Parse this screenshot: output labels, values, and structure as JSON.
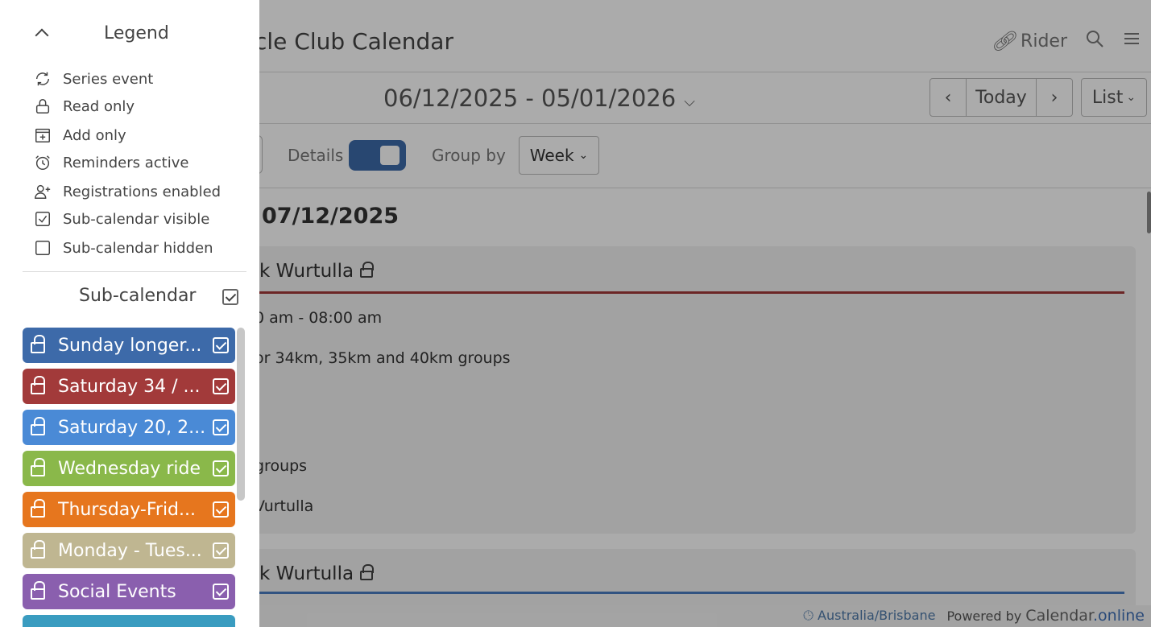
{
  "app": {
    "title_visible": "cle Club Calendar",
    "user_label": "Rider"
  },
  "nav": {
    "date_range": "06/12/2025 - 05/01/2026",
    "today_label": "Today",
    "view_label": "List"
  },
  "toolbar": {
    "details_label": "Details",
    "details_on": true,
    "group_by_label": "Group by",
    "group_by_value": "Week"
  },
  "agenda": {
    "date_heading": "07/12/2025",
    "events": [
      {
        "title_visible": "k Wurtulla",
        "color": "#a23a3a",
        "rows": [
          "0 am - 08:00 am",
          "or 34km, 35km and 40km groups",
          ",",
          ",",
          ",",
          "groups",
          "Vurtulla"
        ]
      },
      {
        "title_visible": "k Wurtulla",
        "color": "#4a7cc0",
        "rows": []
      }
    ]
  },
  "footer": {
    "timezone": "Australia/Brisbane",
    "powered_by": "Powered by",
    "brand_name": "Calendar",
    "brand_suffix": ".online"
  },
  "legend": {
    "title": "Legend",
    "items": [
      {
        "icon": "series-icon",
        "label": "Series event"
      },
      {
        "icon": "lock-icon",
        "label": "Read only"
      },
      {
        "icon": "add-only-icon",
        "label": "Add only"
      },
      {
        "icon": "alarm-icon",
        "label": "Reminders active"
      },
      {
        "icon": "add-user-icon",
        "label": "Registrations enabled"
      },
      {
        "icon": "checkbox-checked-icon",
        "label": "Sub-calendar visible"
      },
      {
        "icon": "checkbox-empty-icon",
        "label": "Sub-calendar hidden"
      }
    ]
  },
  "subcalendars": {
    "header_label": "Sub-calendar",
    "items": [
      {
        "name": "Sunday longer...",
        "color": "#3d6aa9"
      },
      {
        "name": "Saturday 34 / ...",
        "color": "#a23a3a"
      },
      {
        "name": "Saturday 20, 2...",
        "color": "#4a8ad6"
      },
      {
        "name": "Wednesday ride",
        "color": "#8ab84a"
      },
      {
        "name": "Thursday-Frid...",
        "color": "#e6761e"
      },
      {
        "name": "Monday - Tues...",
        "color": "#bfb691"
      },
      {
        "name": "Social Events",
        "color": "#8a5fae"
      },
      {
        "name": "",
        "color": "#3a9cc0"
      }
    ]
  }
}
